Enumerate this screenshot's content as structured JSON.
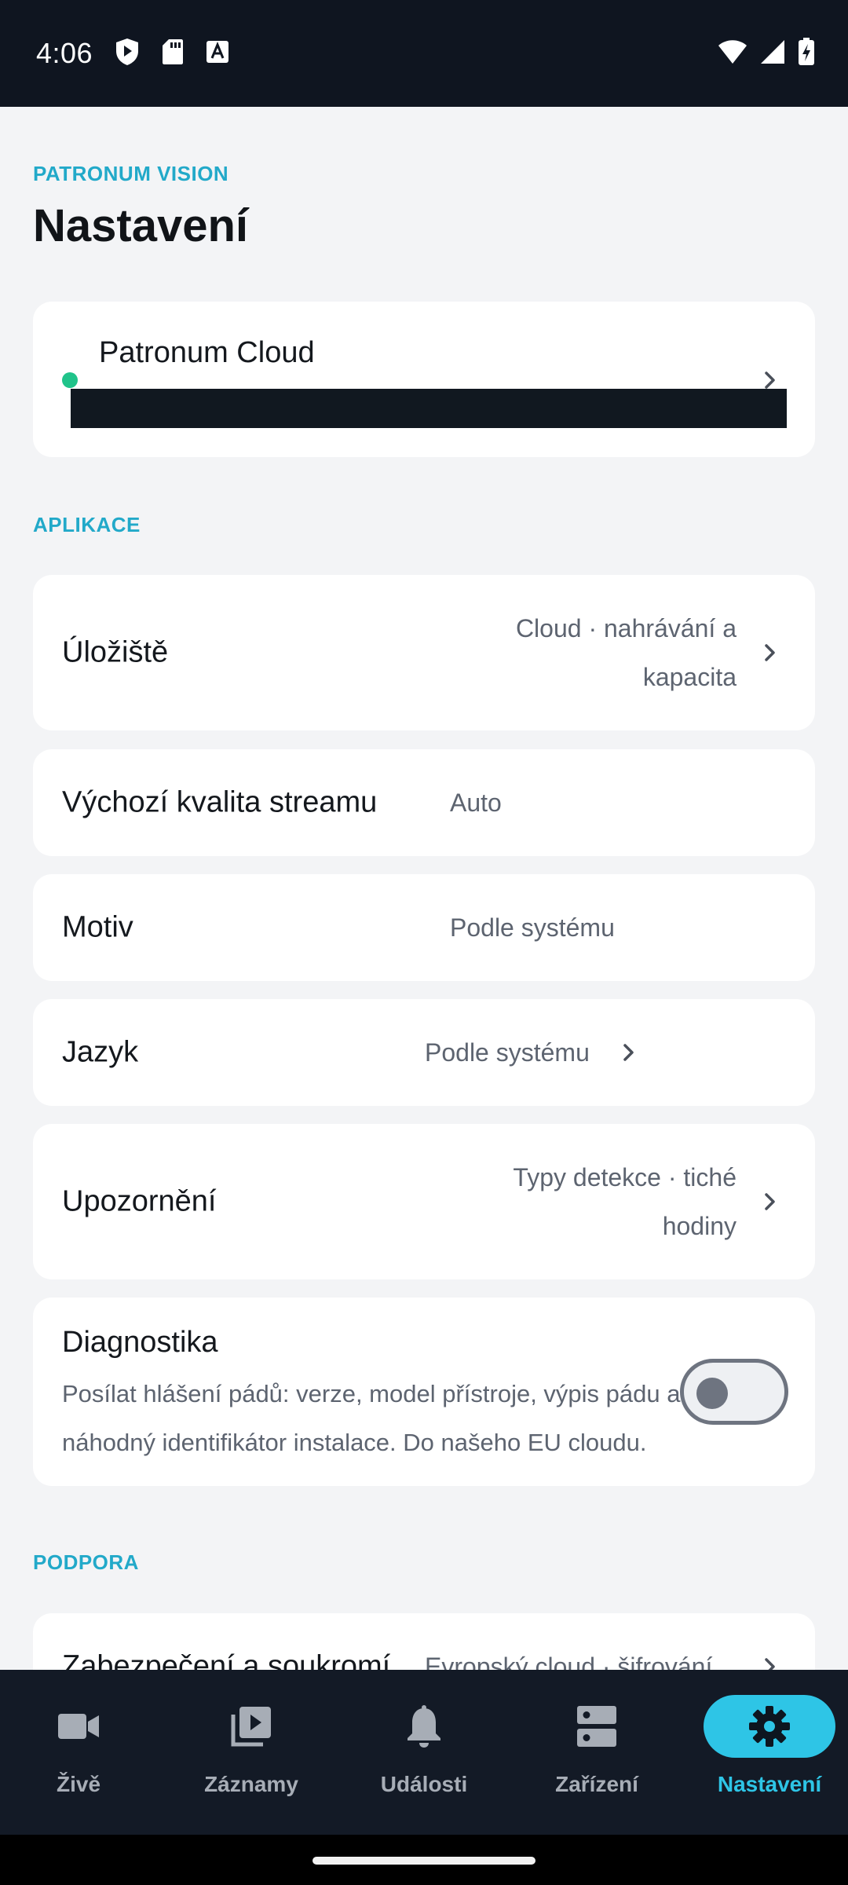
{
  "status_bar": {
    "time": "4:06"
  },
  "header": {
    "brand": "PATRONUM VISION",
    "title": "Nastavení"
  },
  "cloud": {
    "title": "Patronum Cloud"
  },
  "sections": {
    "app": "APLIKACE",
    "support": "PODPORA"
  },
  "rows": {
    "storage": {
      "label": "Úložiště",
      "value_line1": "Cloud · nahrávání a",
      "value_line2": "kapacita"
    },
    "stream_quality": {
      "label": "Výchozí kvalita streamu",
      "value": "Auto"
    },
    "theme": {
      "label": "Motiv",
      "value": "Podle systému"
    },
    "language": {
      "label": "Jazyk",
      "value": "Podle systému"
    },
    "notifications": {
      "label": "Upozornění",
      "value_line1": "Typy detekce · tiché",
      "value_line2": "hodiny"
    },
    "diagnostics": {
      "label": "Diagnostika",
      "desc_line1": "Posílat hlášení pádů: verze, model přístroje, výpis pádu a",
      "desc_line2": "náhodný identifikátor instalace. Do našeho EU cloudu.",
      "enabled": false
    },
    "security": {
      "label": "Zabezpečení a soukromí",
      "value": "Evropský cloud · šifrování"
    }
  },
  "bottom_nav": [
    {
      "label": "Živě",
      "icon": "videocam-icon",
      "active": false
    },
    {
      "label": "Záznamy",
      "icon": "video-library-icon",
      "active": false
    },
    {
      "label": "Události",
      "icon": "bell-icon",
      "active": false
    },
    {
      "label": "Zařízení",
      "icon": "devices-icon",
      "active": false
    },
    {
      "label": "Nastavení",
      "icon": "gear-icon",
      "active": true
    }
  ],
  "colors": {
    "accent": "#2ec5e6",
    "section_label": "#22a9c9",
    "online_dot": "#20c38a",
    "nav_background": "#131a26",
    "background": "#f3f4f6"
  }
}
